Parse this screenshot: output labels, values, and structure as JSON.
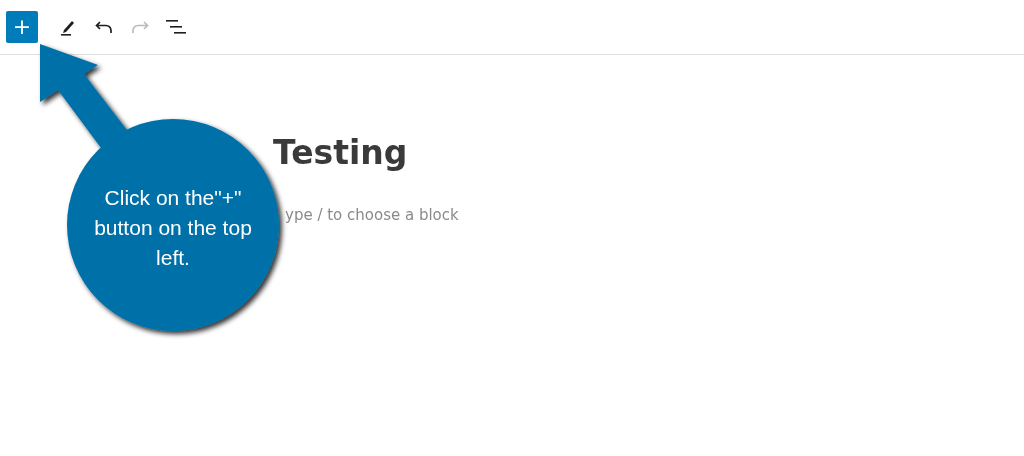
{
  "toolbar": {
    "add_label": "+",
    "items": [
      {
        "kind": "edit"
      },
      {
        "kind": "undo",
        "disabled": false
      },
      {
        "kind": "redo",
        "disabled": true
      },
      {
        "kind": "list"
      }
    ]
  },
  "post": {
    "title": "Testing",
    "placeholder": "ype / to choose a block"
  },
  "callout": {
    "text": "Click on the\"+\" button on the top left."
  }
}
